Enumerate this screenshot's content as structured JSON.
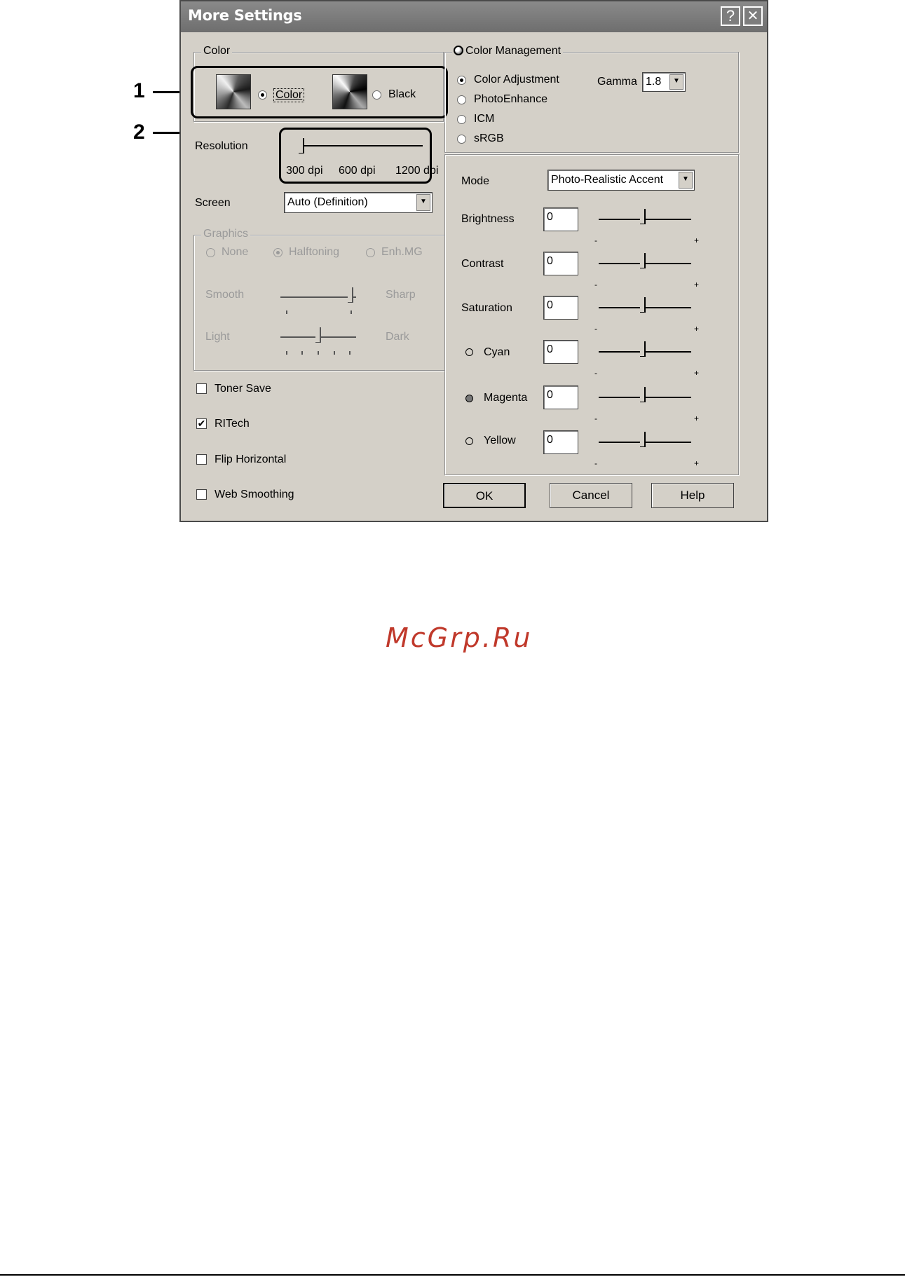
{
  "dialog": {
    "title": "More Settings",
    "help_btn": "?",
    "close_btn": "✕"
  },
  "color_group": {
    "label": "Color",
    "color_option": "Color",
    "black_option": "Black",
    "selected": "Color"
  },
  "resolution": {
    "label": "Resolution",
    "ticks": [
      "300 dpi",
      "600 dpi",
      "1200 dpi"
    ],
    "value": "300 dpi"
  },
  "screen": {
    "label": "Screen",
    "value": "Auto (Definition)"
  },
  "graphics": {
    "label": "Graphics",
    "options": [
      "None",
      "Halftoning",
      "Enh.MG"
    ],
    "selected": "Halftoning",
    "smooth_label": "Smooth",
    "sharp_label": "Sharp",
    "light_label": "Light",
    "dark_label": "Dark"
  },
  "checkboxes": [
    {
      "label": "Toner Save",
      "checked": false
    },
    {
      "label": "RITech",
      "checked": true
    },
    {
      "label": "Flip Horizontal",
      "checked": false
    },
    {
      "label": "Web Smoothing",
      "checked": false
    }
  ],
  "color_management": {
    "label": "Color Management",
    "options": [
      "Color Adjustment",
      "PhotoEnhance",
      "ICM",
      "sRGB"
    ],
    "selected": "Color Adjustment",
    "gamma_label": "Gamma",
    "gamma_value": "1.8"
  },
  "mode": {
    "label": "Mode",
    "value": "Photo-Realistic Accent"
  },
  "adjustments": [
    {
      "label": "Brightness",
      "value": "0"
    },
    {
      "label": "Contrast",
      "value": "0"
    },
    {
      "label": "Saturation",
      "value": "0"
    },
    {
      "label": "Cyan",
      "value": "0"
    },
    {
      "label": "Magenta",
      "value": "0"
    },
    {
      "label": "Yellow",
      "value": "0"
    }
  ],
  "slider_minus": "-",
  "slider_plus": "+",
  "buttons": {
    "ok": "OK",
    "cancel": "Cancel",
    "help": "Help"
  },
  "annotations": [
    "1",
    "2"
  ],
  "watermark": "McGrp.Ru",
  "colors": {
    "dialog_bg": "#d4d0c8",
    "titlebar": "#7a7a7a",
    "watermark": "#c0392b"
  }
}
